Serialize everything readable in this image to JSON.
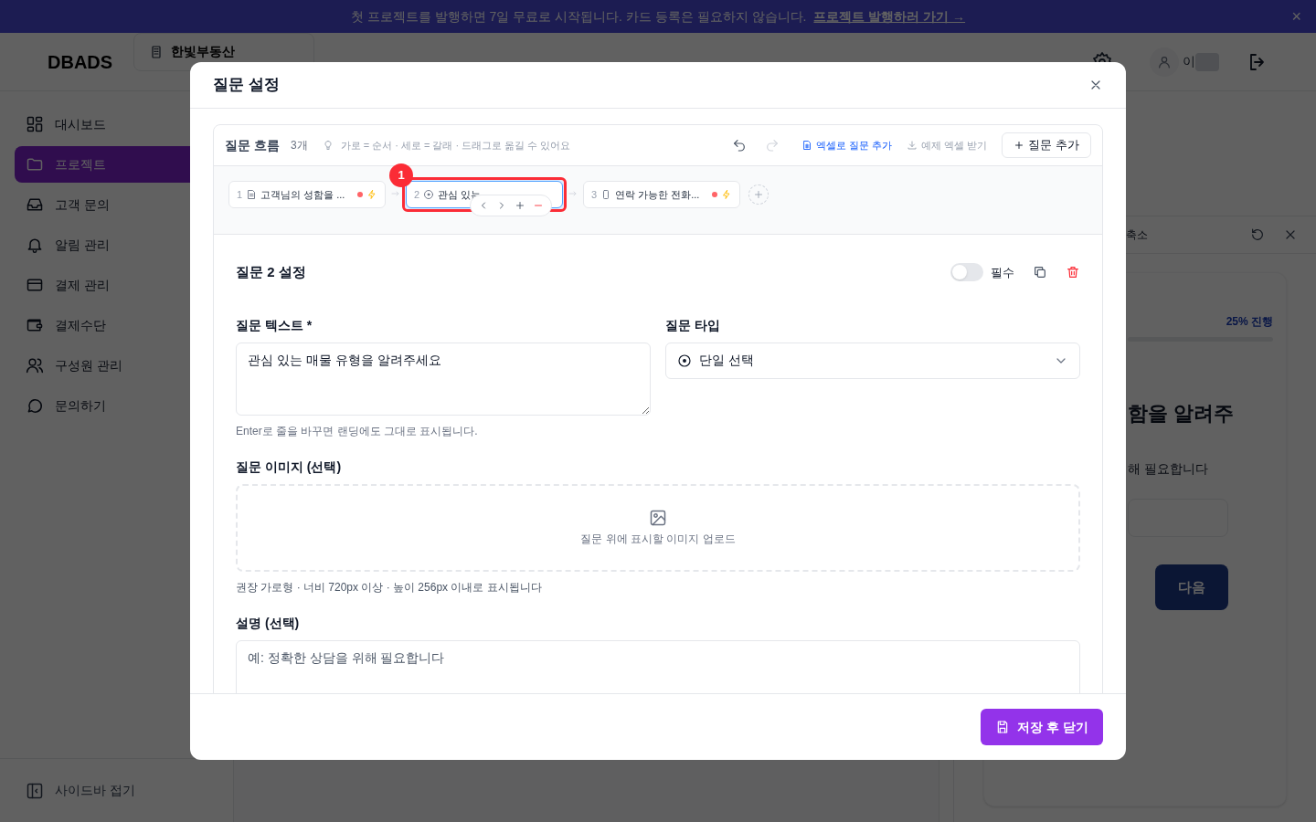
{
  "banner": {
    "text": "첫 프로젝트를 발행하면 7일 무료로 시작됩니다. 카드 등록은 필요하지 않습니다.",
    "link": "프로젝트 발행하러 가기 →",
    "close": "×"
  },
  "header": {
    "logo": "DBADS",
    "workspace": "한빛부동산",
    "user_name": "이"
  },
  "sidebar": {
    "items": [
      {
        "label": "대시보드",
        "kind": "grid",
        "selected": false
      },
      {
        "label": "프로젝트",
        "kind": "folder",
        "selected": true
      },
      {
        "label": "고객 문의",
        "kind": "inbox",
        "selected": false
      },
      {
        "label": "알림 관리",
        "kind": "bell",
        "selected": false
      },
      {
        "label": "결제 관리",
        "kind": "card",
        "selected": false
      },
      {
        "label": "결제수단",
        "kind": "wallet",
        "selected": false
      },
      {
        "label": "구성원 관리",
        "kind": "users",
        "selected": false
      },
      {
        "label": "문의하기",
        "kind": "chat",
        "selected": false
      }
    ],
    "collapse": "사이드바 접기"
  },
  "preview": {
    "zoom_label": "축소",
    "progress": "25% 진행",
    "heading": "함을 알려주",
    "description": "해 필요합니다",
    "next": "다음"
  },
  "modal": {
    "title": "질문 설정",
    "flow": {
      "title": "질문 흐름",
      "count": "3개",
      "hint": "가로 = 순서 · 세로 = 갈래 · 드래그로 옮길 수 있어요",
      "redo_disabled": true,
      "excel_import": "엑셀로 질문 추가",
      "excel_sample": "예제 엑셀 받기",
      "add_button": "질문 추가",
      "nodes": [
        {
          "number": "1",
          "label": "고객님의 성함을 ...",
          "kind": "text",
          "selected": false,
          "flags": true
        },
        {
          "number": "2",
          "label": "관심 있는",
          "kind": "choice",
          "selected": true,
          "flags": false
        },
        {
          "number": "3",
          "label": "연락 가능한 전화...",
          "kind": "phone",
          "selected": false,
          "flags": true
        }
      ],
      "annotation": {
        "badge": "1"
      }
    },
    "settings": {
      "title": "질문 2 설정",
      "required": {
        "label": "필수",
        "on": false
      },
      "text_label": "질문 텍스트 *",
      "text_value": "관심 있는 매물 유형을 알려주세요",
      "text_hint": "Enter로 줄을 바꾸면 랜딩에도 그대로 표시됩니다.",
      "type_label": "질문 타입",
      "type_value": "단일 선택",
      "image_label": "질문 이미지 (선택)",
      "image_upload": "질문 위에 표시할 이미지 업로드",
      "image_hint": "권장 가로형 · 너비 720px 이상 · 높이 256px 이내로 표시됩니다",
      "desc_label": "설명 (선택)",
      "desc_placeholder": "예: 정확한 상담을 위해 필요합니다"
    },
    "save_button": "저장 후 닫기"
  }
}
